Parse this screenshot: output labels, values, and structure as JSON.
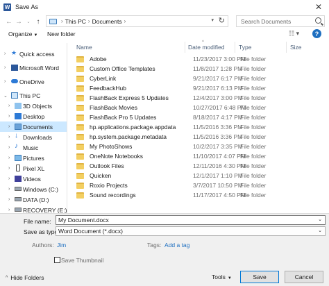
{
  "window": {
    "title": "Save As",
    "app_icon": "W",
    "close_glyph": "✕"
  },
  "address": {
    "segments": [
      "This PC",
      "Documents"
    ],
    "search_placeholder": "Search Documents"
  },
  "toolbar": {
    "organize": "Organize",
    "new_folder": "New folder",
    "help": "?"
  },
  "nav": {
    "items": [
      {
        "label": "Quick access",
        "icon": "star-icon"
      },
      {
        "label": "Microsoft Word",
        "icon": "word-icon"
      },
      {
        "label": "OneDrive",
        "icon": "cloud-icon"
      },
      {
        "label": "This PC",
        "icon": "computer-icon"
      },
      {
        "label": "3D Objects",
        "icon": "cube-icon"
      },
      {
        "label": "Desktop",
        "icon": "desktop-icon"
      },
      {
        "label": "Documents",
        "icon": "documents-icon"
      },
      {
        "label": "Downloads",
        "icon": "download-icon"
      },
      {
        "label": "Music",
        "icon": "music-icon"
      },
      {
        "label": "Pictures",
        "icon": "pictures-icon"
      },
      {
        "label": "Pixel XL",
        "icon": "phone-icon"
      },
      {
        "label": "Videos",
        "icon": "videos-icon"
      },
      {
        "label": "Windows (C:)",
        "icon": "drive-icon"
      },
      {
        "label": "DATA (D:)",
        "icon": "drive-icon"
      },
      {
        "label": "RECOVERY (E:)",
        "icon": "drive-icon"
      }
    ]
  },
  "columns": {
    "name": "Name",
    "date": "Date modified",
    "type": "Type",
    "size": "Size"
  },
  "files": [
    {
      "name": "Adobe",
      "date": "11/23/2017 3:00 PM",
      "type": "File folder"
    },
    {
      "name": "Custom Office Templates",
      "date": "11/8/2017 1:28 PM",
      "type": "File folder"
    },
    {
      "name": "CyberLink",
      "date": "9/21/2017 6:17 PM",
      "type": "File folder"
    },
    {
      "name": "FeedbackHub",
      "date": "9/21/2017 6:13 PM",
      "type": "File folder"
    },
    {
      "name": "FlashBack Express 5 Updates",
      "date": "12/4/2017 3:00 PM",
      "type": "File folder"
    },
    {
      "name": "FlashBack Movies",
      "date": "10/27/2017 6:48 PM",
      "type": "File folder"
    },
    {
      "name": "FlashBack Pro 5 Updates",
      "date": "8/18/2017 4:17 PM",
      "type": "File folder"
    },
    {
      "name": "hp.applications.package.appdata",
      "date": "11/5/2016 3:36 PM",
      "type": "File folder"
    },
    {
      "name": "hp.system.package.metadata",
      "date": "11/5/2016 3:36 PM",
      "type": "File folder"
    },
    {
      "name": "My PhotoShows",
      "date": "10/2/2017 3:35 PM",
      "type": "File folder"
    },
    {
      "name": "OneNote Notebooks",
      "date": "11/10/2017 4:07 PM",
      "type": "File folder"
    },
    {
      "name": "Outlook Files",
      "date": "12/11/2016 4:30 PM",
      "type": "File folder"
    },
    {
      "name": "Quicken",
      "date": "12/1/2017 1:10 PM",
      "type": "File folder"
    },
    {
      "name": "Roxio Projects",
      "date": "3/7/2017 10:50 PM",
      "type": "File folder"
    },
    {
      "name": "Sound recordings",
      "date": "11/17/2017 4:50 PM",
      "type": "File folder"
    }
  ],
  "form": {
    "file_name_label": "File name:",
    "file_name_value": "My Document.docx",
    "save_type_label": "Save as type:",
    "save_type_value": "Word Document (*.docx)",
    "authors_label": "Authors:",
    "authors_value": "Jim",
    "tags_label": "Tags:",
    "tags_value": "Add a tag",
    "thumbnail_label": "Save Thumbnail"
  },
  "footer": {
    "hide_folders": "Hide Folders",
    "tools": "Tools",
    "save": "Save",
    "cancel": "Cancel"
  }
}
